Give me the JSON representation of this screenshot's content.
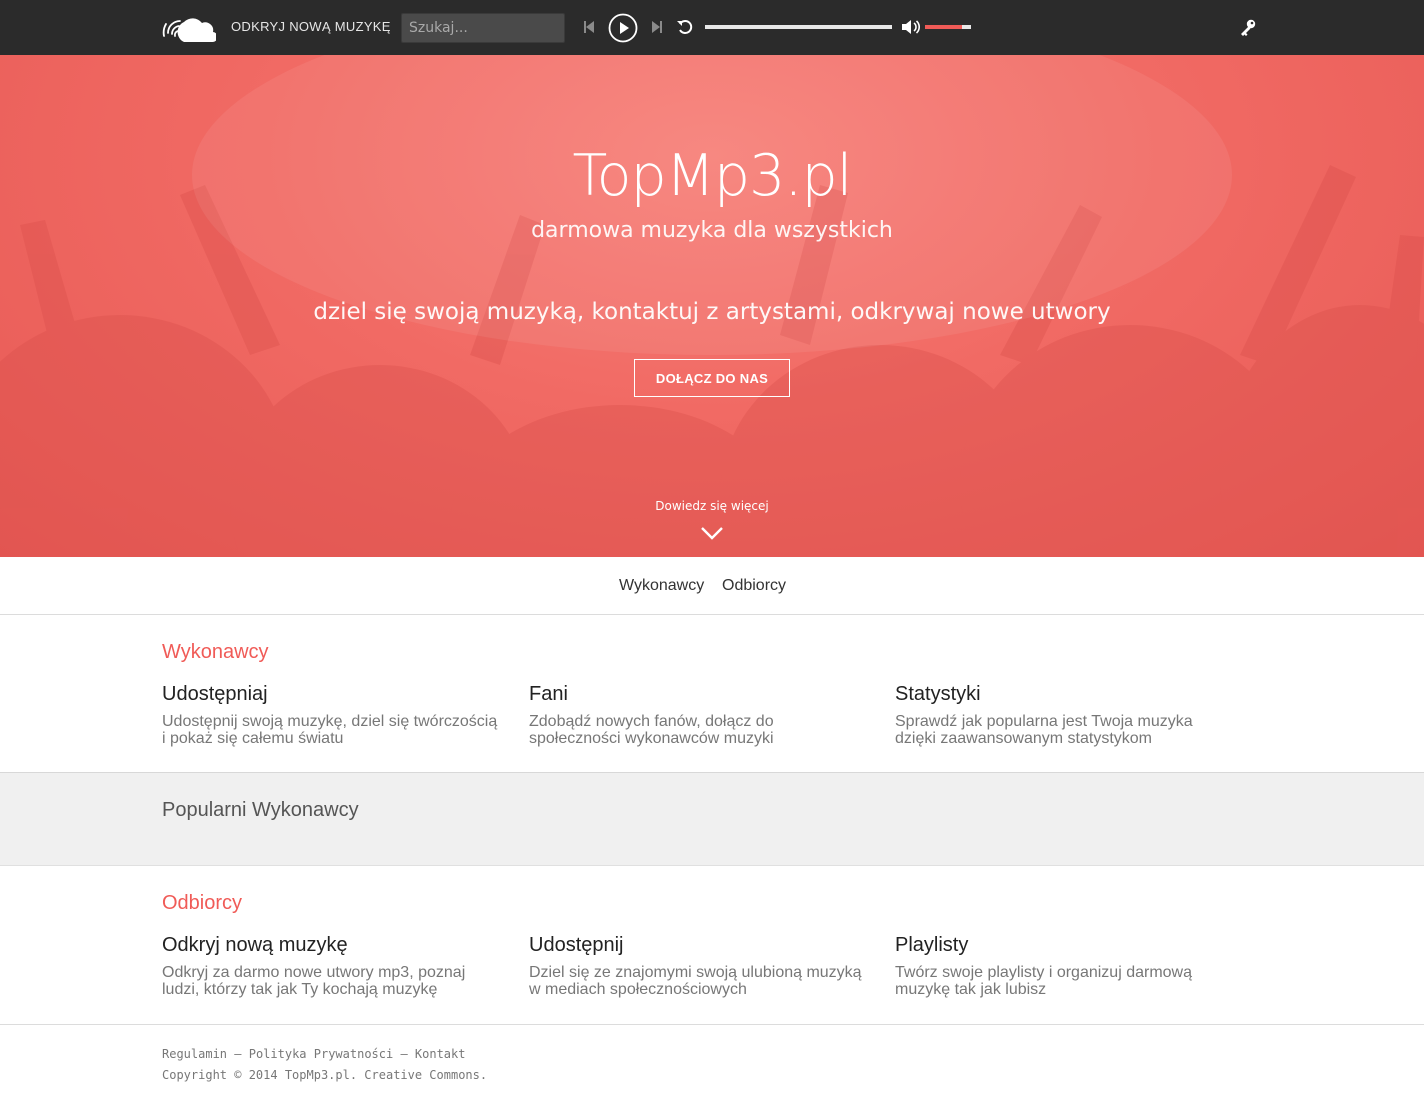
{
  "colors": {
    "accent": "#f05b57",
    "topbar": "#2b2b2b",
    "hero": "#f16a64"
  },
  "header": {
    "discover_label": "ODKRYJ NOWĄ MUZYKĘ",
    "search_placeholder": "Szukaj...",
    "player": {
      "progress": 0,
      "volume": 0.8
    },
    "icons": [
      "cloud-logo-icon",
      "prev-icon",
      "play-icon",
      "next-icon",
      "repeat-icon",
      "volume-icon",
      "key-icon"
    ]
  },
  "hero": {
    "title": "TopMp3.pl",
    "subtitle": "darmowa muzyka dla wszystkich",
    "tagline": "dziel się swoją muzyką, kontaktuj z artystami, odkrywaj nowe utwory",
    "join_label": "DOŁĄCZ DO NAS",
    "learn_more": "Dowiedz się więcej"
  },
  "tabs": [
    {
      "label": "Wykonawcy"
    },
    {
      "label": "Odbiorcy"
    }
  ],
  "artists": {
    "title": "Wykonawcy",
    "features": [
      {
        "title": "Udostępniaj",
        "text": "Udostępnij swoją muzykę, dziel się twórczością i pokaż się całemu światu"
      },
      {
        "title": "Fani",
        "text": "Zdobądź nowych fanów, dołącz do społeczności wykonawców muzyki"
      },
      {
        "title": "Statystyki",
        "text": "Sprawdź jak popularna jest Twoja muzyka dzięki zaawansowanym statystykom"
      }
    ]
  },
  "popular": {
    "title": "Popularni Wykonawcy"
  },
  "listeners": {
    "title": "Odbiorcy",
    "features": [
      {
        "title": "Odkryj nową muzykę",
        "text": "Odkryj za darmo nowe utwory mp3, poznaj ludzi, którzy tak jak Ty kochają muzykę"
      },
      {
        "title": "Udostępnij",
        "text": "Dziel się ze znajomymi swoją ulubioną muzyką w mediach społecznościowych"
      },
      {
        "title": "Playlisty",
        "text": "Twórz swoje playlisty i organizuj darmową muzykę tak jak lubisz"
      }
    ]
  },
  "footer": {
    "links": [
      {
        "label": "Regulamin"
      },
      {
        "label": "Polityka Prywatności"
      },
      {
        "label": "Kontakt"
      }
    ],
    "separator": " – ",
    "copyright": "Copyright © 2014 TopMp3.pl. Creative Commons."
  }
}
